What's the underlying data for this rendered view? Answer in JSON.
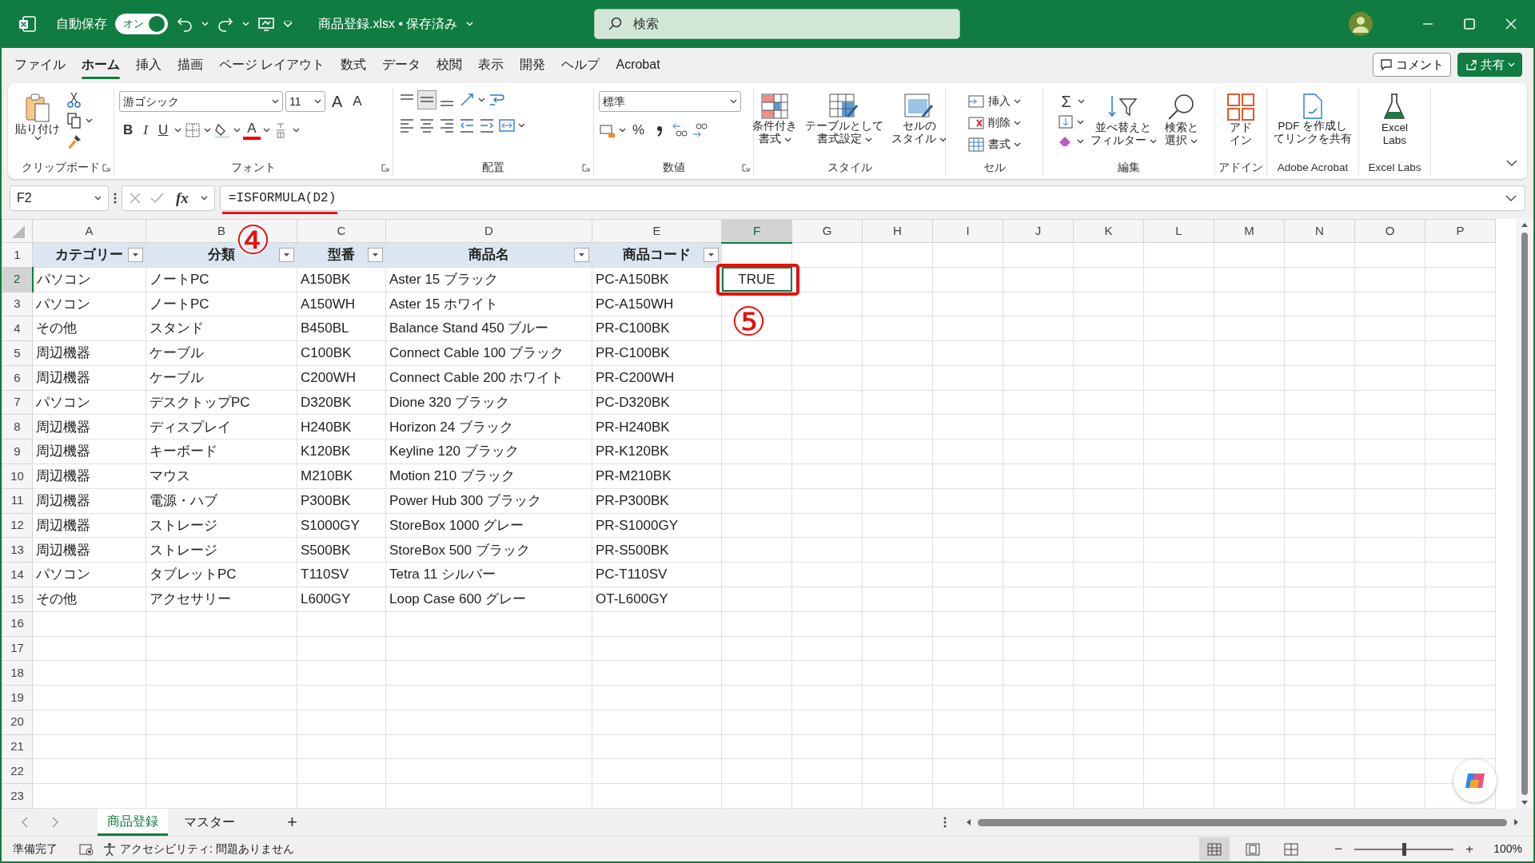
{
  "title_bar": {
    "autosave_label": "自動保存",
    "autosave_toggle": {
      "label": "オン",
      "on": true
    },
    "document_title": "商品登録.xlsx • 保存済み",
    "search": {
      "placeholder": "検索"
    }
  },
  "menu_tabs": [
    {
      "label": "ファイル",
      "selected": false
    },
    {
      "label": "ホーム",
      "selected": true
    },
    {
      "label": "挿入",
      "selected": false
    },
    {
      "label": "描画",
      "selected": false
    },
    {
      "label": "ページ レイアウト",
      "selected": false
    },
    {
      "label": "数式",
      "selected": false
    },
    {
      "label": "データ",
      "selected": false
    },
    {
      "label": "校閲",
      "selected": false
    },
    {
      "label": "表示",
      "selected": false
    },
    {
      "label": "開発",
      "selected": false
    },
    {
      "label": "ヘルプ",
      "selected": false
    },
    {
      "label": "Acrobat",
      "selected": false
    }
  ],
  "header_buttons": [
    "コメント",
    "共有"
  ],
  "ribbon": {
    "groups": [
      {
        "label": "クリップボード",
        "buttons": [
          "貼り付け"
        ]
      },
      {
        "label": "フォント",
        "fields": [
          "游ゴシック",
          "11"
        ],
        "glyphs": [
          "A",
          "A",
          "B",
          "I",
          "U",
          "A"
        ]
      },
      {
        "label": "配置"
      },
      {
        "label": "数値",
        "fields": [
          "標準"
        ],
        "glyphs": [
          "%"
        ]
      },
      {
        "label": "スタイル",
        "buttons": [
          [
            "条件付き",
            "書式"
          ],
          [
            "テーブルとして",
            "書式設定"
          ],
          [
            "セルの",
            "スタイル"
          ]
        ]
      },
      {
        "label": "セル",
        "buttons": [
          "挿入",
          "削除",
          "書式"
        ]
      },
      {
        "label": "編集",
        "glyphs": [
          "Σ"
        ],
        "buttons": [
          [
            "並べ替えと",
            "フィルター"
          ],
          [
            "検索と",
            "選択"
          ]
        ]
      },
      {
        "label": "アドイン",
        "buttons": [
          [
            "アド",
            "イン"
          ]
        ]
      },
      {
        "label": "Adobe Acrobat",
        "buttons": [
          [
            "PDF を作成し",
            "てリンクを共有"
          ]
        ]
      },
      {
        "label": "Excel Labs",
        "buttons": [
          [
            "Excel",
            "Labs"
          ]
        ]
      }
    ]
  },
  "formula_bar": {
    "name_box": "F2",
    "function_glyph": "fx",
    "formula": "=ISFORMULA(D2)"
  },
  "sheet": {
    "columns": [
      {
        "label": "A",
        "selected": false
      },
      {
        "label": "B",
        "selected": false
      },
      {
        "label": "C",
        "selected": false
      },
      {
        "label": "D",
        "selected": false
      },
      {
        "label": "E",
        "selected": false
      },
      {
        "label": "F",
        "selected": true
      },
      {
        "label": "G",
        "selected": false
      },
      {
        "label": "H",
        "selected": false
      },
      {
        "label": "I",
        "selected": false
      },
      {
        "label": "J",
        "selected": false
      },
      {
        "label": "K",
        "selected": false
      },
      {
        "label": "L",
        "selected": false
      },
      {
        "label": "M",
        "selected": false
      },
      {
        "label": "N",
        "selected": false
      },
      {
        "label": "O",
        "selected": false
      },
      {
        "label": "P",
        "selected": false
      }
    ],
    "rows": [
      {
        "number": "1",
        "selected": false,
        "kind": "table-header",
        "cells": [
          "カテゴリー",
          "分類",
          "型番",
          "商品名",
          "商品コード"
        ]
      },
      {
        "number": "2",
        "selected": true,
        "kind": "data",
        "cells": [
          "パソコン",
          "ノートPC",
          "A150BK",
          "Aster 15 ブラック",
          "PC-A150BK",
          "TRUE"
        ]
      },
      {
        "number": "3",
        "selected": false,
        "kind": "data",
        "cells": [
          "パソコン",
          "ノートPC",
          "A150WH",
          "Aster 15 ホワイト",
          "PC-A150WH"
        ]
      },
      {
        "number": "4",
        "selected": false,
        "kind": "data",
        "cells": [
          "その他",
          "スタンド",
          "B450BL",
          "Balance Stand 450 ブルー",
          "PR-C100BK"
        ]
      },
      {
        "number": "5",
        "selected": false,
        "kind": "data",
        "cells": [
          "周辺機器",
          "ケーブル",
          "C100BK",
          "Connect Cable 100 ブラック",
          "PR-C100BK"
        ]
      },
      {
        "number": "6",
        "selected": false,
        "kind": "data",
        "cells": [
          "周辺機器",
          "ケーブル",
          "C200WH",
          "Connect Cable 200 ホワイト",
          "PR-C200WH"
        ]
      },
      {
        "number": "7",
        "selected": false,
        "kind": "data",
        "cells": [
          "パソコン",
          "デスクトップPC",
          "D320BK",
          "Dione 320 ブラック",
          "PC-D320BK"
        ]
      },
      {
        "number": "8",
        "selected": false,
        "kind": "data",
        "cells": [
          "周辺機器",
          "ディスプレイ",
          "H240BK",
          "Horizon 24 ブラック",
          "PR-H240BK"
        ]
      },
      {
        "number": "9",
        "selected": false,
        "kind": "data",
        "cells": [
          "周辺機器",
          "キーボード",
          "K120BK",
          "Keyline 120 ブラック",
          "PR-K120BK"
        ]
      },
      {
        "number": "10",
        "selected": false,
        "kind": "data",
        "cells": [
          "周辺機器",
          "マウス",
          "M210BK",
          "Motion 210 ブラック",
          "PR-M210BK"
        ]
      },
      {
        "number": "11",
        "selected": false,
        "kind": "data",
        "cells": [
          "周辺機器",
          "電源・ハブ",
          "P300BK",
          "Power Hub 300 ブラック",
          "PR-P300BK"
        ]
      },
      {
        "number": "12",
        "selected": false,
        "kind": "data",
        "cells": [
          "周辺機器",
          "ストレージ",
          "S1000GY",
          "StoreBox 1000 グレー",
          "PR-S1000GY"
        ]
      },
      {
        "number": "13",
        "selected": false,
        "kind": "data",
        "cells": [
          "周辺機器",
          "ストレージ",
          "S500BK",
          "StoreBox 500 ブラック",
          "PR-S500BK"
        ]
      },
      {
        "number": "14",
        "selected": false,
        "kind": "data",
        "cells": [
          "パソコン",
          "タブレットPC",
          "T110SV",
          "Tetra 11 シルバー",
          "PC-T110SV"
        ]
      },
      {
        "number": "15",
        "selected": false,
        "kind": "data",
        "cells": [
          "その他",
          "アクセサリー",
          "L600GY",
          "Loop Case 600 グレー",
          "OT-L600GY"
        ]
      },
      {
        "number": "16",
        "selected": false,
        "kind": "data"
      },
      {
        "number": "17",
        "selected": false,
        "kind": "data"
      },
      {
        "number": "18",
        "selected": false,
        "kind": "data"
      },
      {
        "number": "19",
        "selected": false,
        "kind": "data"
      },
      {
        "number": "20",
        "selected": false,
        "kind": "data"
      },
      {
        "number": "21",
        "selected": false,
        "kind": "data"
      },
      {
        "number": "22",
        "selected": false,
        "kind": "data"
      },
      {
        "number": "23",
        "selected": false,
        "kind": "data"
      }
    ]
  },
  "annotations": [
    {
      "text": "④"
    },
    {
      "text": "⑤"
    }
  ],
  "sheet_tabs": [
    {
      "label": "商品登録",
      "selected": true
    },
    {
      "label": "マスター",
      "selected": false
    }
  ],
  "add_sheet_glyph": "+",
  "status_bar": {
    "ready": "準備完了",
    "accessibility": "アクセシビリティ: 問題ありません",
    "zoom_out": "−",
    "zoom_in": "+",
    "zoom": {
      "level": 0.5,
      "reading": "100%"
    }
  }
}
